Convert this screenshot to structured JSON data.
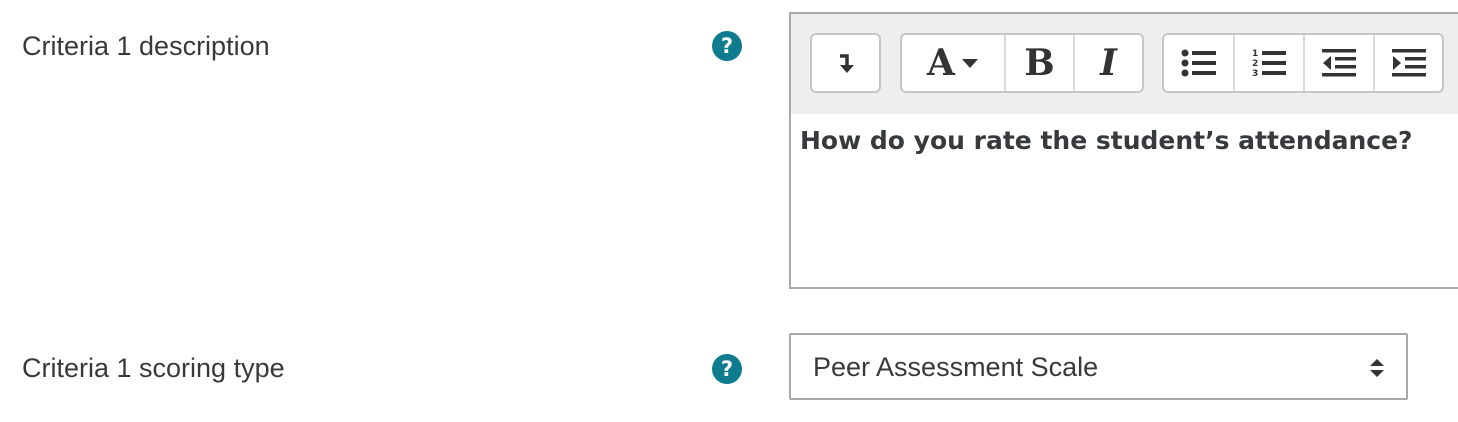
{
  "criteria1": {
    "description_label": "Criteria 1 description",
    "scoring_type_label": "Criteria 1 scoring type"
  },
  "help_icon": {
    "glyph": "?",
    "color": "#0f7b8e"
  },
  "editor": {
    "toolbar": {
      "collapse_icon": "collapse-toolbar-icon",
      "style_label": "A",
      "bold_label": "B",
      "italic_label": "I",
      "unordered_list_icon": "unordered-list-icon",
      "ordered_list_icon": "ordered-list-icon",
      "outdent_icon": "outdent-icon",
      "indent_icon": "indent-icon"
    },
    "content": "How do you rate the student’s attendance?"
  },
  "scoring_type_select": {
    "selected": "Peer Assessment Scale"
  }
}
